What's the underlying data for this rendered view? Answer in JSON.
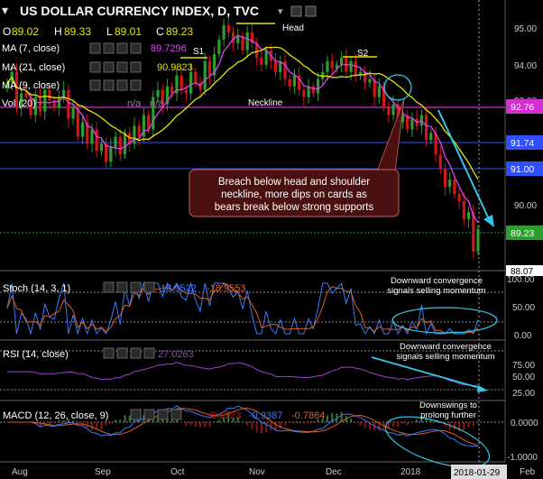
{
  "header": {
    "title": "US DOLLAR CURRENCY INDEX, D, TVC",
    "ohlc": {
      "o_label": "O",
      "o": "89.02",
      "h_label": "H",
      "h": "89.33",
      "l_label": "L",
      "l": "89.01",
      "c_label": "C",
      "c": "89.23"
    }
  },
  "indicators": {
    "ma7": {
      "label": "MA (7, close)",
      "value": "89.7296",
      "color": "#e040fb"
    },
    "ma21": {
      "label": "MA (21, close)",
      "value": "90.9823",
      "color": "#e5e500"
    },
    "ma9": {
      "label": "MA (9, close)"
    },
    "vol": {
      "label": "Vol (20)",
      "na1": "n/a",
      "na2": "n/a",
      "na3": "n/a"
    }
  },
  "annotations": {
    "head": "Head",
    "s1": "S1",
    "s2": "S2",
    "neckline": "Neckline",
    "callout": [
      "Breach below head and shoulder",
      "neckline, more dips on cards as",
      "bears break below strong supports"
    ]
  },
  "price_tags": {
    "current": "89.23",
    "neck": "92.76",
    "s1": "91.74",
    "s2": "91.00",
    "bottom": "88.07"
  },
  "stoch": {
    "label": "Stoch (14, 3, 1)",
    "k": "18.9522",
    "d": "-18.9553",
    "note": [
      "Downward convergence",
      "signals selling momentum"
    ]
  },
  "rsi": {
    "label": "RSI (14, close)",
    "value": "27.0263",
    "note": [
      "Downward convergence",
      "signals selling momentum"
    ]
  },
  "macd": {
    "label": "MACD (12, 26, close, 9)",
    "v1": "-0.1523",
    "v2": "-0.9387",
    "v3": "-0.7864",
    "note": [
      "Downswings to",
      "prolong further"
    ]
  },
  "x_axis": {
    "labels": [
      "Aug",
      "Sep",
      "Oct",
      "Nov",
      "Dec",
      "2018",
      "Feb"
    ],
    "current_date": "2018-01-29"
  },
  "chart_data": {
    "type": "candlestick",
    "title": "US DOLLAR CURRENCY INDEX, D, TVC",
    "y_axis_ticks": [
      95.0,
      94.0,
      93.0,
      92.0,
      91.0,
      90.0,
      89.0
    ],
    "ylim": [
      88.07,
      95.3
    ],
    "key_levels": [
      92.76,
      91.74,
      91.0
    ],
    "last_close": 89.23,
    "x_months": [
      "Aug",
      "Sep",
      "Oct",
      "Nov",
      "Dec",
      "2018",
      "Feb"
    ],
    "approx_closes": [
      93.3,
      93.6,
      92.6,
      93.0,
      92.9,
      92.4,
      92.9,
      92.5,
      93.1,
      92.8,
      92.6,
      92.9,
      93.1,
      92.3,
      92.6,
      91.8,
      92.2,
      91.6,
      92.0,
      91.4,
      91.6,
      91.1,
      91.5,
      91.8,
      91.3,
      91.9,
      91.6,
      92.1,
      91.8,
      92.4,
      92.0,
      92.9,
      93.1,
      92.7,
      93.2,
      93.0,
      93.5,
      93.1,
      93.0,
      93.6,
      93.3,
      93.1,
      93.9,
      93.5,
      94.1,
      94.5,
      94.9,
      94.7,
      94.4,
      94.6,
      94.2,
      94.7,
      94.4,
      94.0,
      93.8,
      94.2,
      93.9,
      93.6,
      93.9,
      93.4,
      93.2,
      93.5,
      93.1,
      92.9,
      93.2,
      93.0,
      93.4,
      93.6,
      93.9,
      93.7,
      93.8,
      94.0,
      93.6,
      93.9,
      93.5,
      93.6,
      93.3,
      93.4,
      92.9,
      93.2,
      92.6,
      92.4,
      92.7,
      92.2,
      92.4,
      92.0,
      92.3,
      92.1,
      92.4,
      91.7,
      91.9,
      91.3,
      90.9,
      90.4,
      90.6,
      90.2,
      90.0,
      89.5,
      89.7,
      88.6,
      89.23
    ],
    "stoch": {
      "k": 18.9522,
      "d": 18.9553,
      "ticks": [
        100,
        50,
        0
      ],
      "series_name": "Stoch (14, 3, 1)"
    },
    "rsi": {
      "value": 27.0263,
      "ticks": [
        75,
        50,
        25
      ],
      "series_name": "RSI (14, close)"
    },
    "macd": {
      "macd": -0.9387,
      "signal": -0.7864,
      "histogram": -0.1523,
      "ticks": [
        0,
        -1
      ],
      "series_name": "MACD (12, 26, close, 9)"
    }
  },
  "y_labels": {
    "main": [
      "95.00",
      "94.00",
      "93.00",
      "90.00"
    ],
    "stoch": [
      "100.00",
      "50.00",
      "0.00"
    ],
    "rsi": [
      "75.00",
      "50.00",
      "25.00"
    ],
    "macd": [
      "0.0000",
      "-1.0000"
    ]
  },
  "colors": {
    "up": "#2e9e2e",
    "down": "#d01818",
    "axis_text": "#c8c8c8",
    "cyan": "#34c6e8",
    "magenta": "#d030d0",
    "blue_line": "#3050ff",
    "callout_bg": "#4a0f0f"
  }
}
